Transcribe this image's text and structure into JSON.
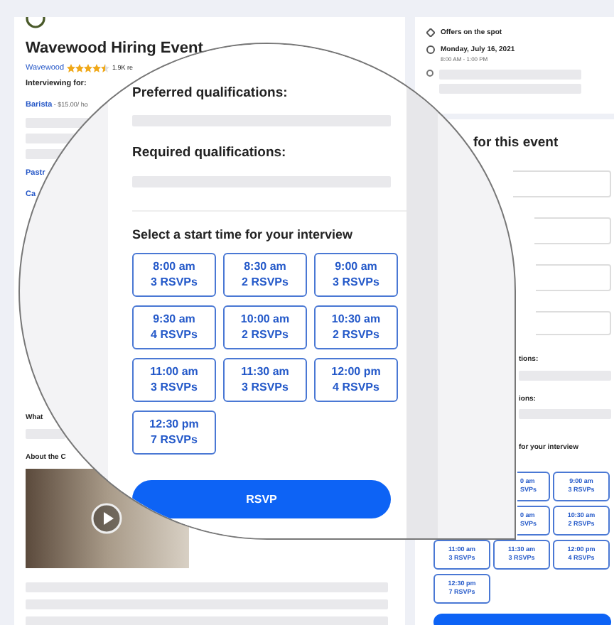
{
  "event": {
    "title": "Wavewood Hiring Event",
    "company": "Wavewood",
    "stars": 4.5,
    "reviews": "1.9K re"
  },
  "left": {
    "interviewing_label": "Interviewing for:",
    "jobs": [
      {
        "title": "Barista",
        "detail": " - $15.00/ ho"
      },
      {
        "title": "Pastr"
      },
      {
        "title": "Ca"
      }
    ],
    "what_label": "What",
    "about_label": "About the C"
  },
  "details": [
    {
      "kind": "offer",
      "text": "Offers on the spot"
    },
    {
      "kind": "date",
      "text": "Monday, July 16, 2021",
      "sub": "8:00 AM - 1:00 PM"
    },
    {
      "kind": "location"
    }
  ],
  "rsvp_form": {
    "title": "for this event",
    "labels": [
      "tions:",
      "ions:"
    ],
    "slots_title": "for your interview",
    "slots": [
      {
        "kind": "partial",
        "time": "0 am",
        "rsvps": "SVPs"
      },
      {
        "kind": "full",
        "time": "9:00 am",
        "rsvps": "3 RSVPs"
      },
      {
        "kind": "partial",
        "time": "0 am",
        "rsvps": "SVPs"
      },
      {
        "kind": "full",
        "time": "10:30 am",
        "rsvps": "2 RSVPs"
      },
      {
        "kind": "full",
        "time": "11:00 am",
        "rsvps": "3 RSVPs"
      },
      {
        "kind": "full",
        "time": "11:30 am",
        "rsvps": "3 RSVPs"
      },
      {
        "kind": "full",
        "time": "12:00 pm",
        "rsvps": "4 RSVPs"
      },
      {
        "kind": "full",
        "time": "12:30 pm",
        "rsvps": "7 RSVPs"
      }
    ]
  },
  "magnifier": {
    "preferred": "Preferred qualifications:",
    "required": "Required qualifications:",
    "slots_title": "Select a start time for your interview",
    "slots": [
      {
        "time": "8:00 am",
        "rsvps": "3 RSVPs"
      },
      {
        "time": "8:30 am",
        "rsvps": "2 RSVPs"
      },
      {
        "time": "9:00 am",
        "rsvps": "3 RSVPs"
      },
      {
        "time": "9:30 am",
        "rsvps": "4 RSVPs"
      },
      {
        "time": "10:00 am",
        "rsvps": "2 RSVPs"
      },
      {
        "time": "10:30 am",
        "rsvps": "2 RSVPs"
      },
      {
        "time": "11:00 am",
        "rsvps": "3 RSVPs"
      },
      {
        "time": "11:30 am",
        "rsvps": "3 RSVPs"
      },
      {
        "time": "12:00 pm",
        "rsvps": "4 RSVPs"
      },
      {
        "time": "12:30 pm",
        "rsvps": "7 RSVPs"
      }
    ],
    "button": "RSVP"
  }
}
